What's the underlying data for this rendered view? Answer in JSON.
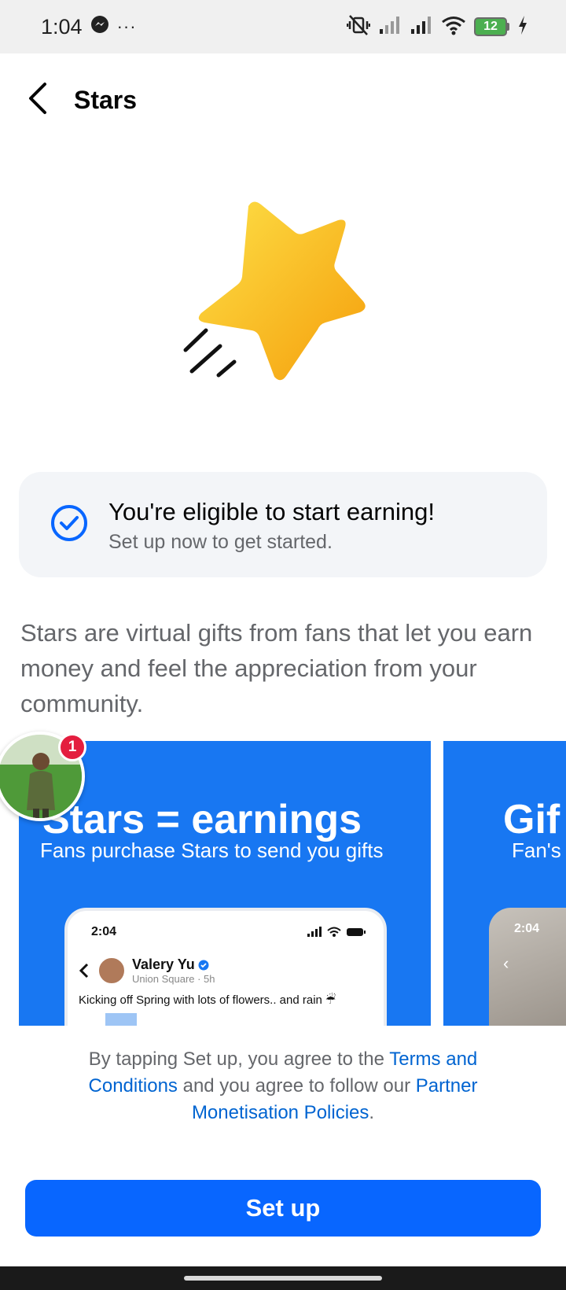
{
  "status_bar": {
    "time": "1:04",
    "more": "···",
    "battery_level": "12",
    "icons": [
      "messenger-icon",
      "mute-vibrate-icon",
      "signal-icon",
      "signal-icon",
      "wifi-icon",
      "battery-icon",
      "charging-icon"
    ]
  },
  "header": {
    "title": "Stars",
    "back_icon": "back-arrow-icon"
  },
  "hero": {
    "icon": "star-icon",
    "colors": {
      "star_top": "#fde047",
      "star_bottom": "#f59e0b"
    }
  },
  "eligibility": {
    "icon": "check-circle-icon",
    "title": "You're eligible to start earning!",
    "subtitle": "Set up now to get started."
  },
  "description": "Stars are virtual gifts from fans that let you earn money and feel the appreciation from your community.",
  "carousel": {
    "slides": [
      {
        "headline": "Stars = earnings",
        "subtitle": "Fans purchase Stars to send you gifts",
        "mock": {
          "time": "2:04",
          "name": "Valery Yu",
          "meta": "Union Square · 5h",
          "caption": "Kicking off Spring with lots of flowers.. and rain ☔"
        }
      },
      {
        "headline": "Gif",
        "subtitle": "Fan's",
        "mock": {
          "time": "2:04"
        }
      }
    ]
  },
  "chat_head": {
    "badge_count": "1"
  },
  "legal": {
    "text_1": "By tapping Set up, you agree to the ",
    "link_terms": "Terms and Conditions",
    "text_2": " and you agree to follow our ",
    "link_policies": "Partner Monetisation Policies",
    "text_3": "."
  },
  "setup_button": {
    "label": "Set up"
  },
  "colors": {
    "brand_blue": "#1877f2",
    "button_blue": "#0866ff",
    "link_blue": "#0064d1",
    "badge_red": "#e41e3f"
  }
}
